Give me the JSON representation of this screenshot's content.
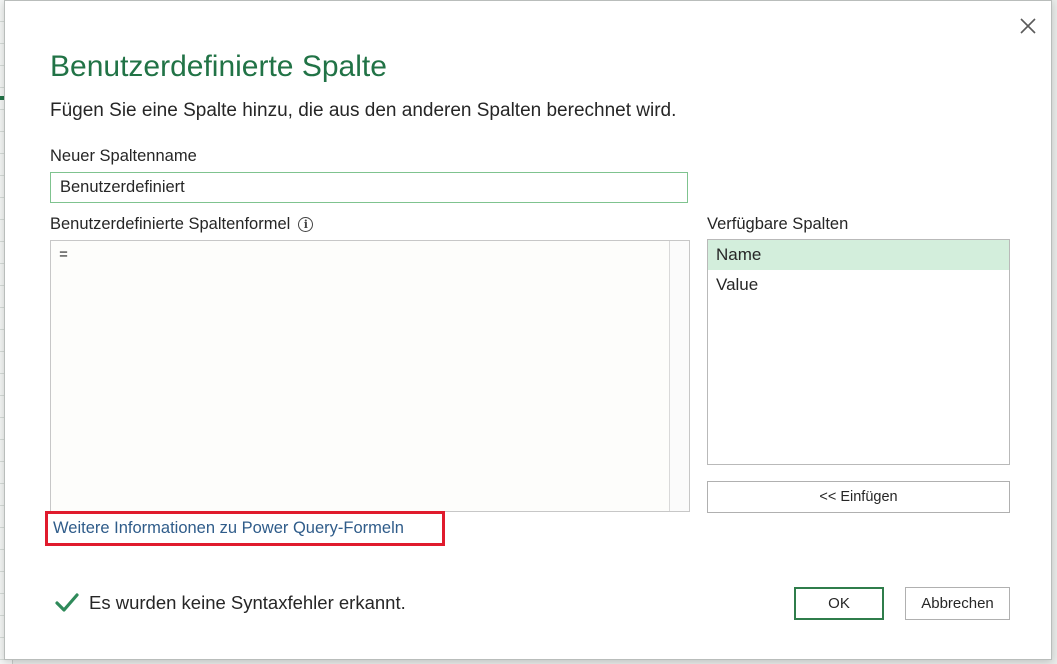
{
  "dialog": {
    "title": "Benutzerdefinierte Spalte",
    "subtitle": "Fügen Sie eine Spalte hinzu, die aus den anderen Spalten berechnet wird."
  },
  "new_column": {
    "label": "Neuer Spaltenname",
    "value": "Benutzerdefiniert"
  },
  "formula": {
    "label": "Benutzerdefinierte Spaltenformel",
    "info_icon": "info-icon",
    "value": "="
  },
  "available_columns": {
    "label": "Verfügbare Spalten",
    "items": [
      {
        "label": "Name",
        "selected": true
      },
      {
        "label": "Value",
        "selected": false
      }
    ],
    "insert_label": "<< Einfügen"
  },
  "help_link": "Weitere Informationen zu Power Query-Formeln",
  "status": {
    "icon": "checkmark-icon",
    "text": "Es wurden keine Syntaxfehler erkannt."
  },
  "buttons": {
    "ok": "OK",
    "cancel": "Abbrechen"
  },
  "colors": {
    "accent": "#217346",
    "selection": "#d3eedc",
    "link": "#2f5c8a",
    "highlight_box": "#e01b2d"
  }
}
